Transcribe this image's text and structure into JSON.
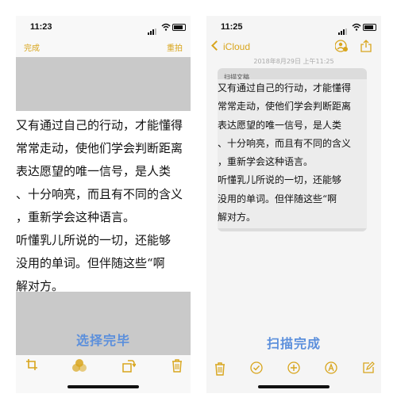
{
  "left": {
    "status_time": "11:23",
    "done_label": "完成",
    "retake_label": "重拍",
    "overlay_label": "选择完毕",
    "text_lines": [
      "又有通过自己的行动，才能懂得",
      "常常走动，使他们学会判断距离",
      "表达愿望的唯一信号，是人类",
      "、十分响亮，而且有不同的含义",
      "，重新学会这种语言。",
      "听懂乳儿所说的一切，还能够",
      "没用的单词。但伴随这些“啊",
      "解对方。"
    ],
    "toolbar_icons": [
      "crop-icon",
      "color-filter-icon",
      "rotate-icon",
      "trash-icon"
    ]
  },
  "right": {
    "status_time": "11:25",
    "back_label": "iCloud",
    "date_text": "2018年8月29日 上午11:25",
    "card_label": "扫描文稿",
    "card_lines": [
      "又有通过自己的行动，才能懂得",
      "常常走动，使他们学会判断距离",
      "表达愿望的唯一信号，是人类",
      "、十分响亮，而且有不同的含义",
      "，重新学会这种语言。",
      "听懂乳儿所说的一切，还能够",
      "没用的单词。但伴随这些“啊",
      "解对方。"
    ],
    "overlay_label": "扫描完成",
    "toolbar_icons": [
      "trash-icon",
      "checklist-icon",
      "add-icon",
      "markup-icon",
      "compose-icon"
    ]
  },
  "colors": {
    "accent": "#d8a51c",
    "overlay_text": "#5b8fdc",
    "mask": "#c9c9c9"
  }
}
